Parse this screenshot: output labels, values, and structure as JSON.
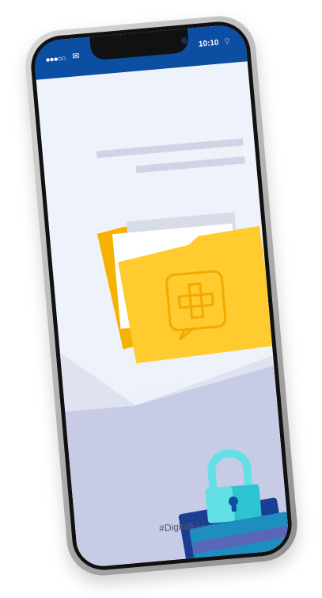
{
  "status_bar": {
    "signal": "●●●○○",
    "mail_icon": "mail-icon",
    "time": "10:10",
    "wifi_icon": "wifi-icon",
    "color": "#0b4ea2"
  },
  "screen": {
    "hashtag": "#DigitalEU",
    "colors": {
      "background_top": "#eef3fb",
      "background_bottom": "#c7cbe6",
      "folder": "#ffcb2f",
      "folder_back": "#f7b100",
      "document": "#d8dbe8",
      "card_front": "#1e8ec0",
      "card_back": "#1a3f92",
      "lock_top": "#62e0e6",
      "lock_body": "#2ec3d1"
    },
    "icons": [
      "folder-icon",
      "medical-cross-icon",
      "lock-icon",
      "credit-card-icon"
    ]
  }
}
